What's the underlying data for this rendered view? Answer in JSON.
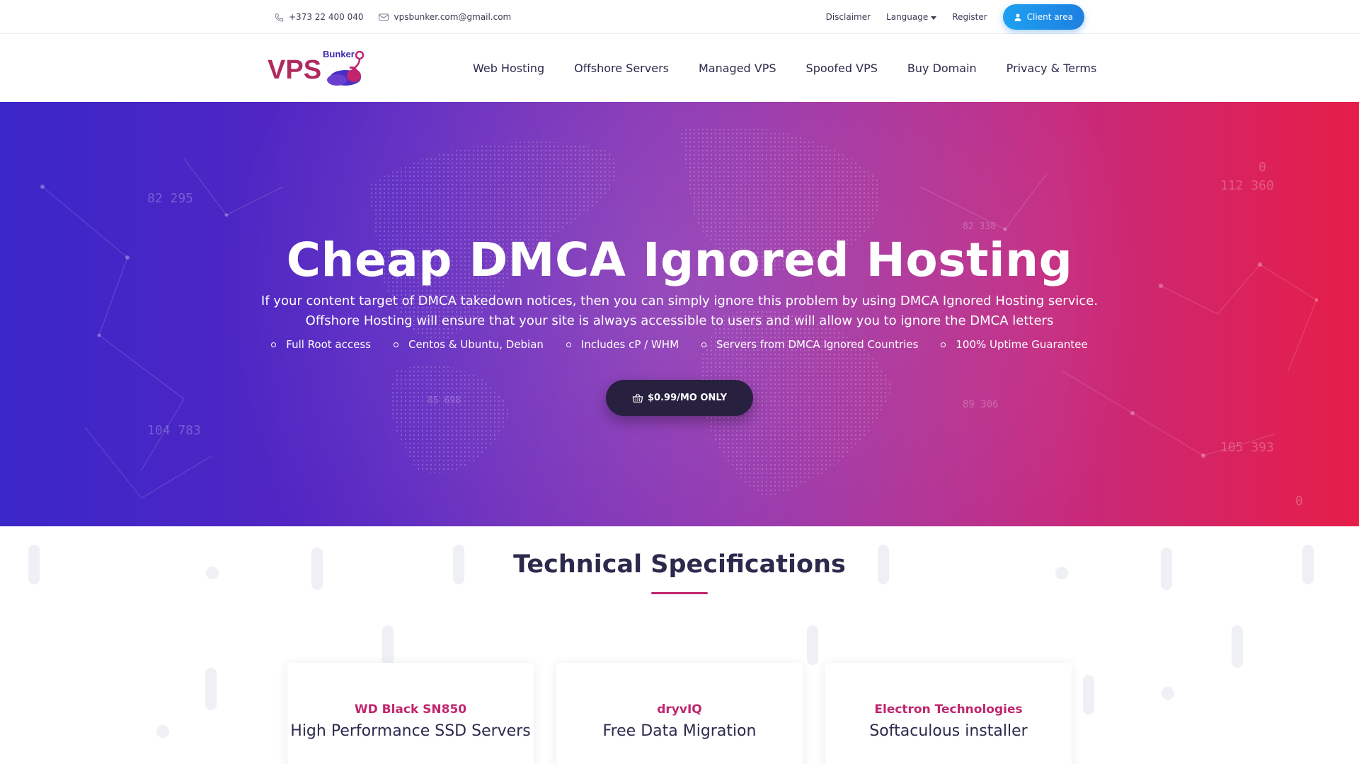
{
  "topbar": {
    "phone": "+373 22 400 040",
    "email": "vpsbunker.com@gmail.com",
    "links": {
      "disclaimer": "Disclaimer",
      "language": "Language",
      "register": "Register"
    },
    "client_area": "Client area"
  },
  "logo": {
    "main": "VPS",
    "sub": "Bunker"
  },
  "nav": [
    "Web Hosting",
    "Offshore Servers",
    "Managed VPS",
    "Spoofed VPS",
    "Buy Domain",
    "Privacy & Terms"
  ],
  "hero": {
    "title": "Cheap DMCA Ignored Hosting",
    "subtitle_line1": "If your content target of DMCA takedown notices, then you can simply ignore this problem by using DMCA Ignored Hosting service.",
    "subtitle_line2": "Offshore Hosting will ensure that your site is always accessible to users and will allow you to ignore the DMCA letters",
    "features": [
      "Full Root access",
      "Centos & Ubuntu, Debian",
      "Includes cP / WHM",
      "Servers from DMCA Ignored Countries",
      "100% Uptime Guarantee"
    ],
    "price_button": "$0.99/MO ONLY",
    "bg_numbers": [
      "82 295",
      "82 338",
      "112 360",
      "0",
      "104 783",
      "85 698",
      "89 306",
      "105 393",
      "0"
    ]
  },
  "specs": {
    "title": "Technical Specifications",
    "cards": [
      {
        "brand": "WD Black SN850",
        "name": "High Performance SSD Servers"
      },
      {
        "brand": "dryvIQ",
        "name": "Free Data Migration"
      },
      {
        "brand": "Electron Technologies",
        "name": "Softaculous installer"
      }
    ]
  },
  "colors": {
    "accent": "#c0256d",
    "dark": "#2b2a4c",
    "client_btn": "#1e8ee9",
    "hero_left": "#3a26c9",
    "hero_right": "#e61d48"
  }
}
